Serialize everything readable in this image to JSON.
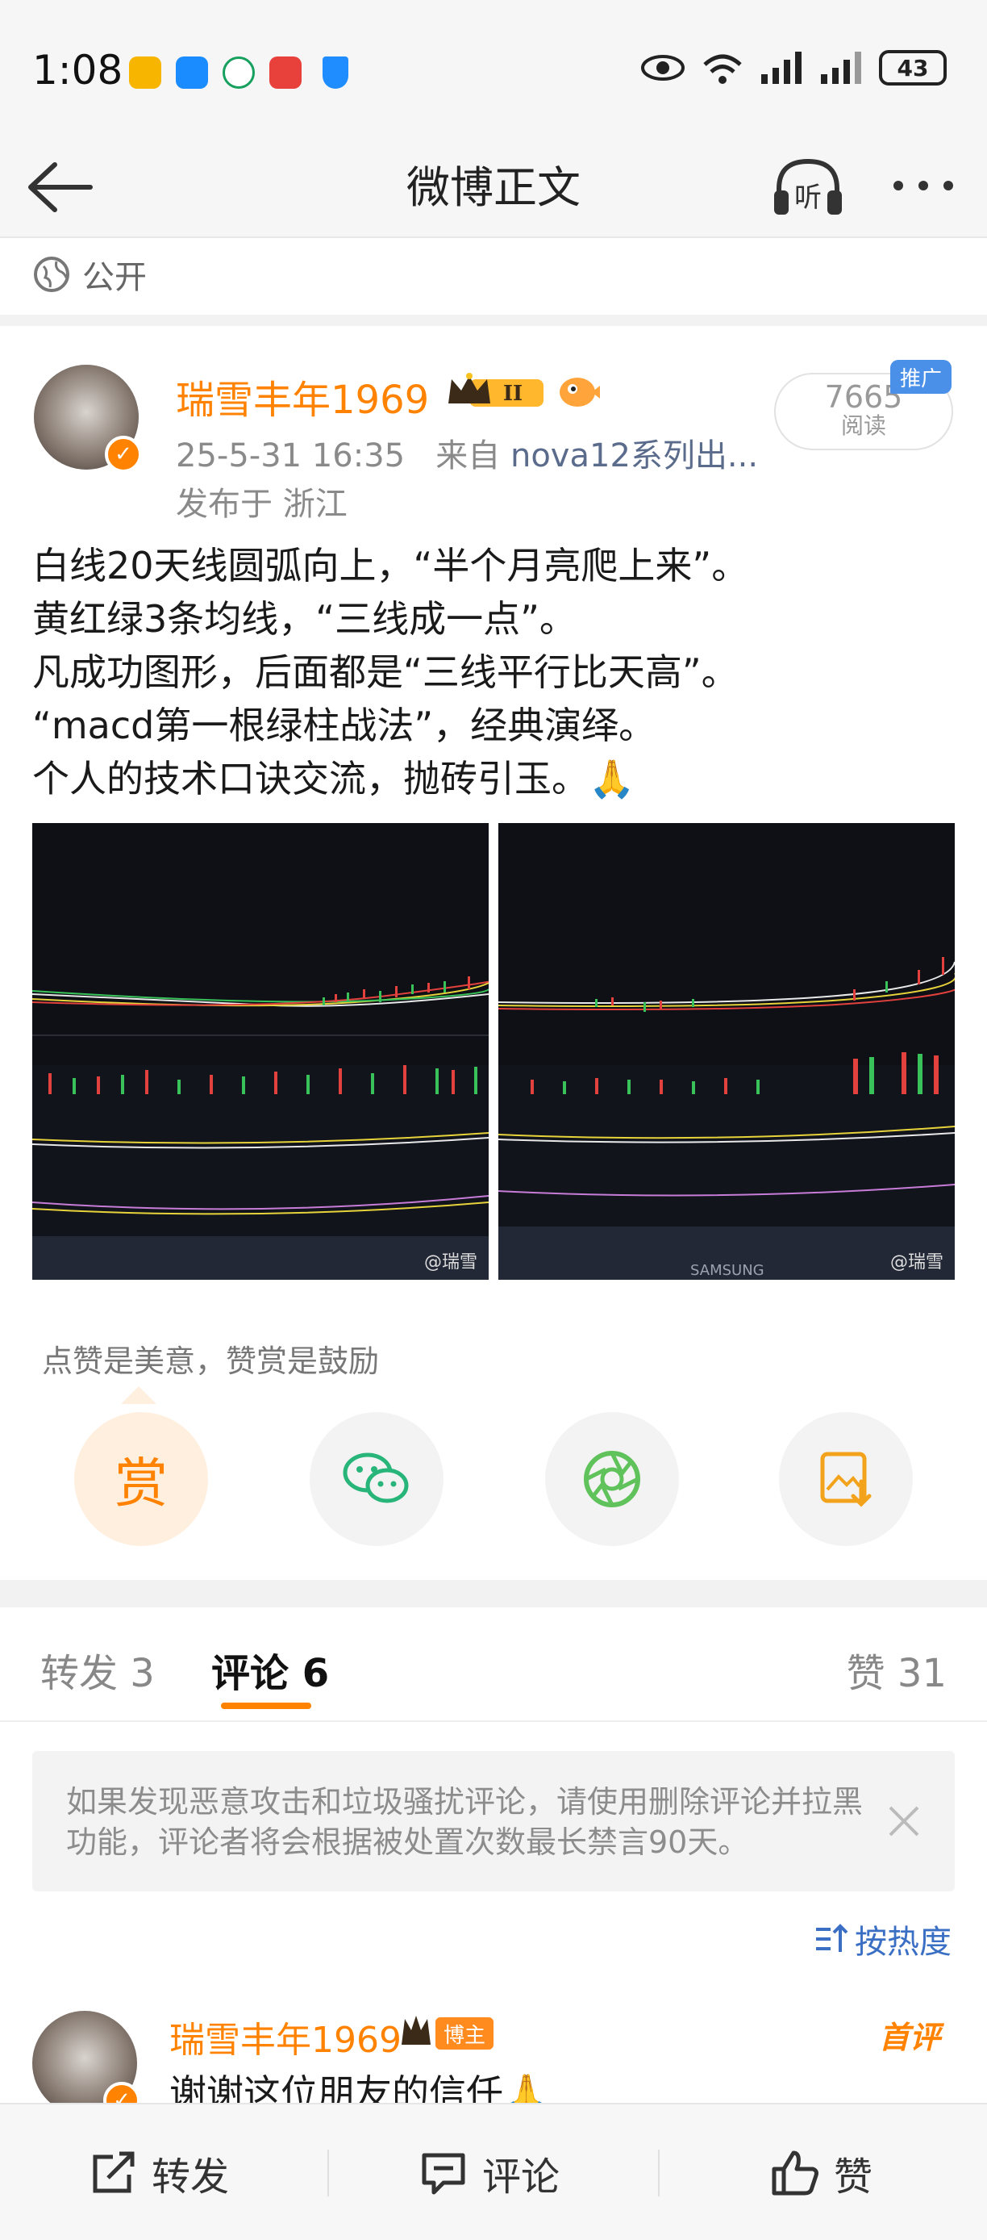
{
  "status_bar": {
    "time": "1:08",
    "network": "6",
    "battery": "43"
  },
  "header": {
    "title": "微博正文",
    "listen_label": "听"
  },
  "visibility": "公开",
  "author": {
    "name": "瑞雪丰年1969",
    "level_badge": "II",
    "timestamp": "25-5-31 16:35",
    "source_prefix": "来自",
    "source": "nova12系列出...",
    "location": "发布于 浙江",
    "read_count": "7665",
    "read_label": "阅读",
    "promo_tag": "推广"
  },
  "post": {
    "lines": [
      "白线20天线圆弧向上，“半个月亮爬上来”。",
      "黄红绿3条均线，“三线成一点”。",
      "凡成功图形，后面都是“三线平行比天高”。",
      "“macd第一根绿柱战法”，经典演绎。",
      "个人的技术口诀交流，抛砖引玉。🙏"
    ],
    "images": [
      {
        "watermark": "@瑞雪"
      },
      {
        "watermark": "@瑞雪",
        "brand": "SAMSUNG"
      }
    ]
  },
  "reward": {
    "hint": "点赞是美意，赞赏是鼓励",
    "reward_label": "赏"
  },
  "tabs": {
    "repost": "转发 3",
    "comment": "评论 6",
    "like": "赞 31"
  },
  "notice": {
    "text": "如果发现恶意攻击和垃圾骚扰评论，请使用删除评论并拉黑功能，评论者将会根据被处置次数最长禁言90天。"
  },
  "sort_label": "按热度",
  "comment": {
    "name": "瑞雪丰年1969",
    "host_badge": "博主",
    "first_badge": "首评",
    "text": "谢谢这位朋友的信任🙏"
  },
  "bottom_bar": {
    "repost": "转发",
    "comment": "评论",
    "like": "赞"
  },
  "colors": {
    "accent": "#ff8200",
    "link": "#3a6fc4",
    "promo": "#4a8fe8"
  }
}
